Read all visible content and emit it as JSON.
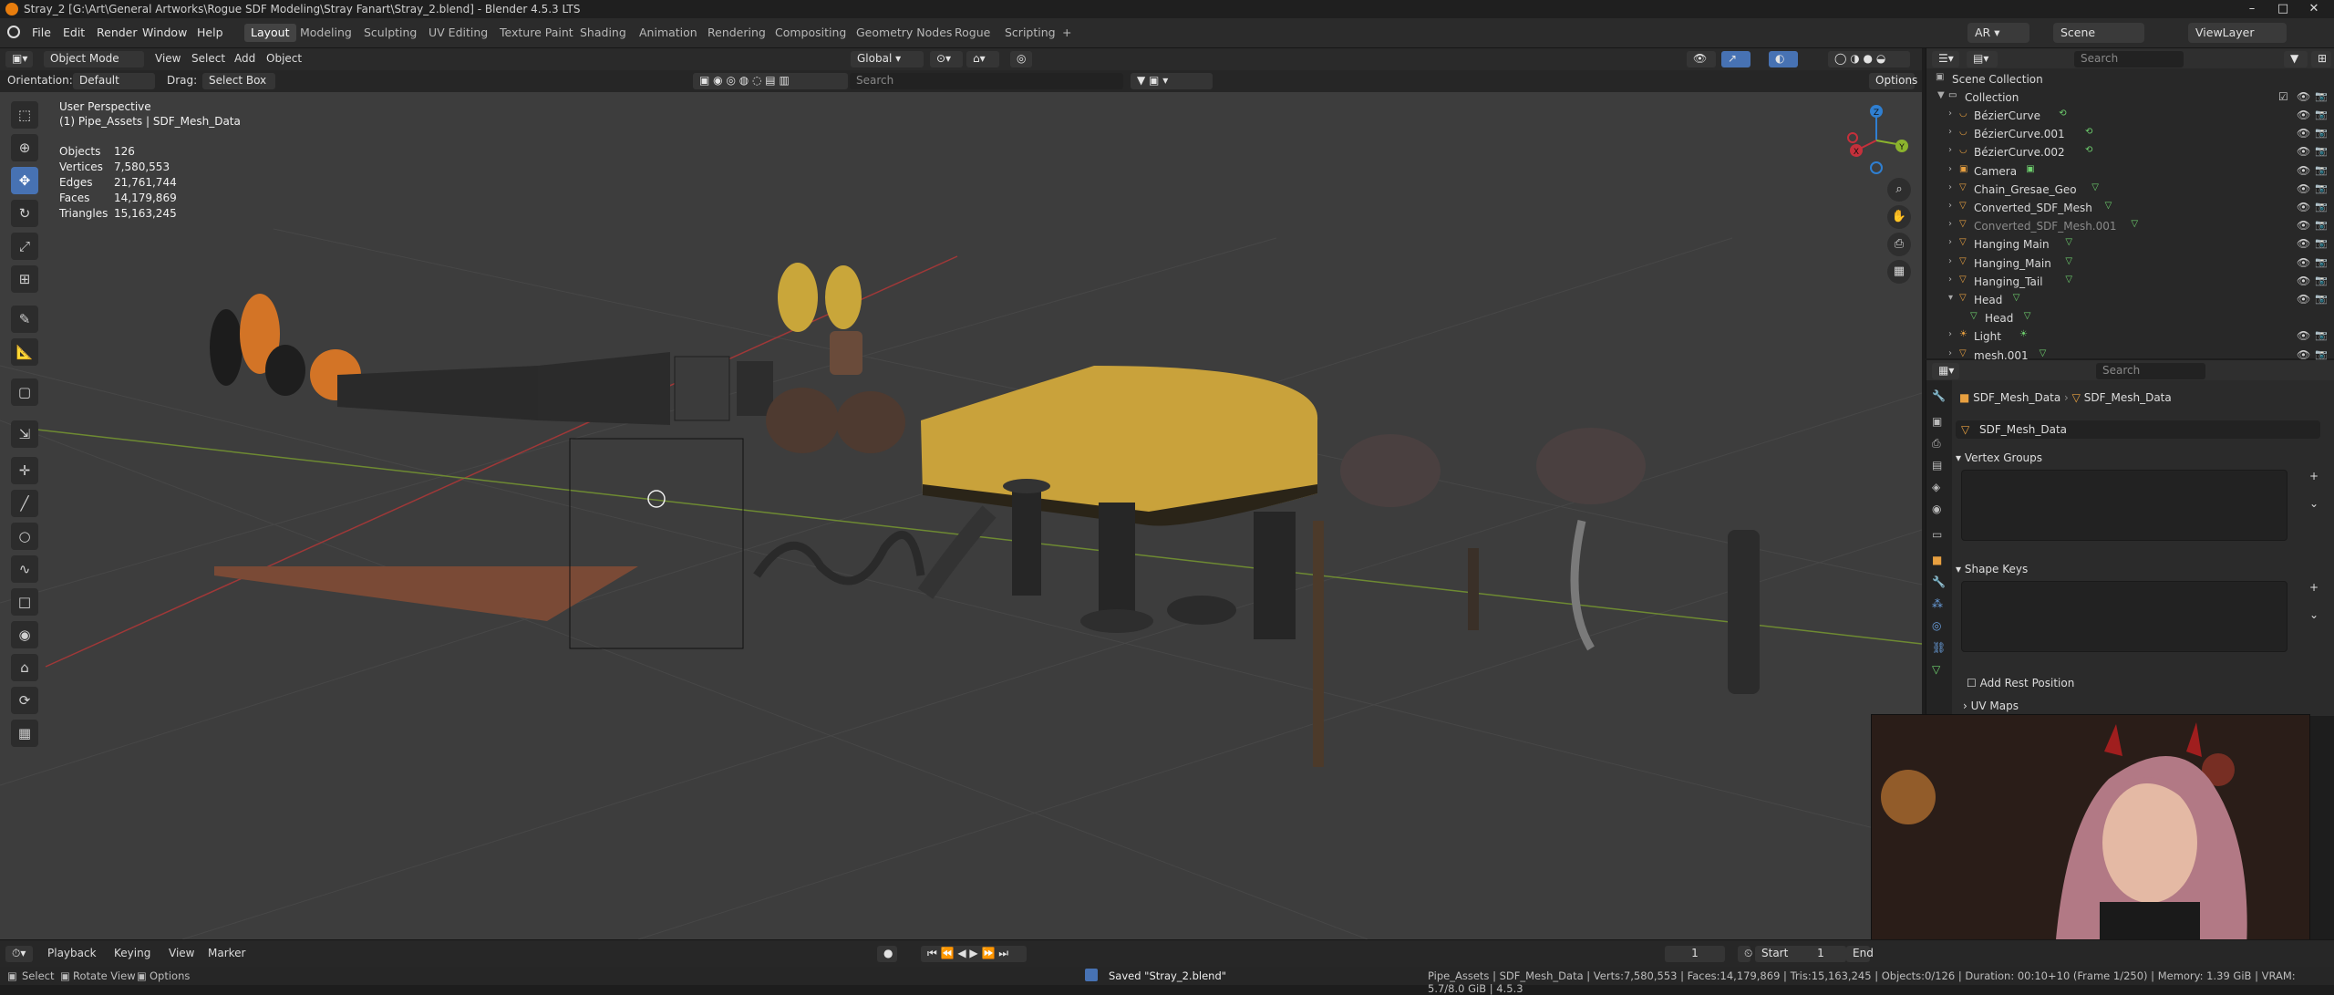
{
  "window": {
    "title": "Stray_2 [G:\\Art\\General Artworks\\Rogue SDF Modeling\\Stray Fanart\\Stray_2.blend] - Blender 4.5.3 LTS",
    "minimize": "–",
    "maximize": "□",
    "close": "✕"
  },
  "menu": [
    "File",
    "Edit",
    "Render",
    "Window",
    "Help"
  ],
  "workspaces": [
    "Layout",
    "Modeling",
    "Sculpting",
    "UV Editing",
    "Texture Paint",
    "Shading",
    "Animation",
    "Rendering",
    "Compositing",
    "Geometry Nodes",
    "Rogue",
    "Scripting"
  ],
  "add_workspace": "+",
  "top_right": {
    "render_engine": "AR",
    "scene": "Scene",
    "view_layer": "ViewLayer"
  },
  "viewport_header": {
    "mode": "Object Mode",
    "view": "View",
    "select": "Select",
    "add": "Add",
    "object": "Object",
    "orientation_transform": "Global",
    "options": "Options"
  },
  "tool_settings": {
    "orientation_label": "Orientation:",
    "orientation_value": "Default",
    "drag_label": "Drag:",
    "drag_value": "Select Box",
    "search_placeholder": "Search"
  },
  "overlay": {
    "view_name": "User Perspective",
    "active": "(1) Pipe_Assets | SDF_Mesh_Data",
    "stats": [
      {
        "label": "Objects",
        "value": "126"
      },
      {
        "label": "Vertices",
        "value": "7,580,553"
      },
      {
        "label": "Edges",
        "value": "21,761,744"
      },
      {
        "label": "Faces",
        "value": "14,179,869"
      },
      {
        "label": "Triangles",
        "value": "15,163,245"
      }
    ]
  },
  "gizmo": {
    "x": "X",
    "y": "Y",
    "z": "Z"
  },
  "outliner": {
    "search_placeholder": "Search",
    "root": "Scene Collection",
    "collection": "Collection",
    "items": [
      {
        "name": "BézierCurve",
        "type": "curve"
      },
      {
        "name": "BézierCurve.001",
        "type": "curve"
      },
      {
        "name": "BézierCurve.002",
        "type": "curve"
      },
      {
        "name": "Camera",
        "type": "camera"
      },
      {
        "name": "Chain_Gresae_Geo",
        "type": "mesh"
      },
      {
        "name": "Converted_SDF_Mesh",
        "type": "mesh"
      },
      {
        "name": "Converted_SDF_Mesh.001",
        "type": "mesh"
      },
      {
        "name": "Hanging Main",
        "type": "mesh"
      },
      {
        "name": "Hanging_Main",
        "type": "mesh"
      },
      {
        "name": "Hanging_Tail",
        "type": "mesh"
      },
      {
        "name": "Head",
        "type": "mesh"
      },
      {
        "name": "Head",
        "type": "mesh-data"
      },
      {
        "name": "Light",
        "type": "light"
      },
      {
        "name": "mesh.001",
        "type": "mesh"
      }
    ]
  },
  "properties": {
    "search_placeholder": "Search",
    "breadcrumb_object": "SDF_Mesh_Data",
    "breadcrumb_data": "SDF_Mesh_Data",
    "datablock": "SDF_Mesh_Data",
    "vertex_groups": "Vertex Groups",
    "shape_keys": "Shape Keys",
    "add_rest_position": "Add Rest Position",
    "uv_maps": "UV Maps"
  },
  "timeline": {
    "playback": "Playback",
    "keying": "Keying",
    "view": "View",
    "marker": "Marker",
    "current_frame": "1",
    "start_label": "Start",
    "start": "1",
    "end_label": "End"
  },
  "status": {
    "select": "Select",
    "rotate": "Rotate View",
    "options": "Options",
    "message": "Saved \"Stray_2.blend\"",
    "stats": "Pipe_Assets | SDF_Mesh_Data | Verts:7,580,553 | Faces:14,179,869 | Tris:15,163,245 | Objects:0/126 | Duration: 00:10+10 (Frame 1/250) | Memory: 1.39 GiB | VRAM: 5.7/8.0 GiB | 4.5.3"
  },
  "colors": {
    "accent": "#4772b3",
    "blender_orange": "#e87d0d",
    "x_axis": "#c5303b",
    "y_axis": "#8bb32d",
    "z_axis": "#2f7fd1"
  }
}
